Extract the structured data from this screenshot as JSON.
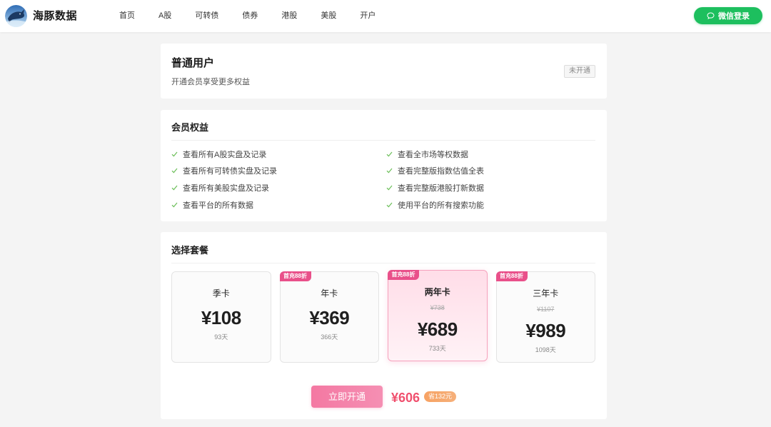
{
  "header": {
    "brand": "海豚数据",
    "logo_icon": "dolphin-logo",
    "nav": [
      "首页",
      "A股",
      "可转债",
      "债券",
      "港股",
      "美股",
      "开户"
    ],
    "login_icon": "chat-bubble-icon",
    "login_label": "微信登录"
  },
  "user_card": {
    "title": "普通用户",
    "subtitle": "开通会员享受更多权益",
    "status": "未开通"
  },
  "benefits": {
    "title": "会员权益",
    "check_icon": "check-icon",
    "items": [
      "查看所有A股实盘及记录",
      "查看全市场等权数据",
      "查看所有可转债实盘及记录",
      "查看完整版指数估值全表",
      "查看所有美股实盘及记录",
      "查看完整版港股打新数据",
      "查看平台的所有数据",
      "使用平台的所有搜索功能"
    ]
  },
  "plans": {
    "title": "选择套餐",
    "selected_index": 2,
    "items": [
      {
        "name": "季卡",
        "price": "¥108",
        "days": "93天"
      },
      {
        "name": "年卡",
        "price": "¥369",
        "days": "366天",
        "badge": "首充88折"
      },
      {
        "name": "两年卡",
        "price": "¥689",
        "original_price": "¥738",
        "days": "733天",
        "badge": "首充88折"
      },
      {
        "name": "三年卡",
        "price": "¥989",
        "original_price": "¥1107",
        "days": "1098天",
        "badge": "首充88折"
      }
    ]
  },
  "checkout": {
    "button_label": "立即开通",
    "total": "¥606",
    "savings": "省132元"
  },
  "colors": {
    "background": "#f4f4f4",
    "accent_pink": "#f478a2",
    "badge_pink": "#e9508a",
    "price_red": "#f0506e",
    "savings_orange": "#f7a263",
    "login_green": "#1dbf5e",
    "check_green": "#6cbf5a"
  }
}
